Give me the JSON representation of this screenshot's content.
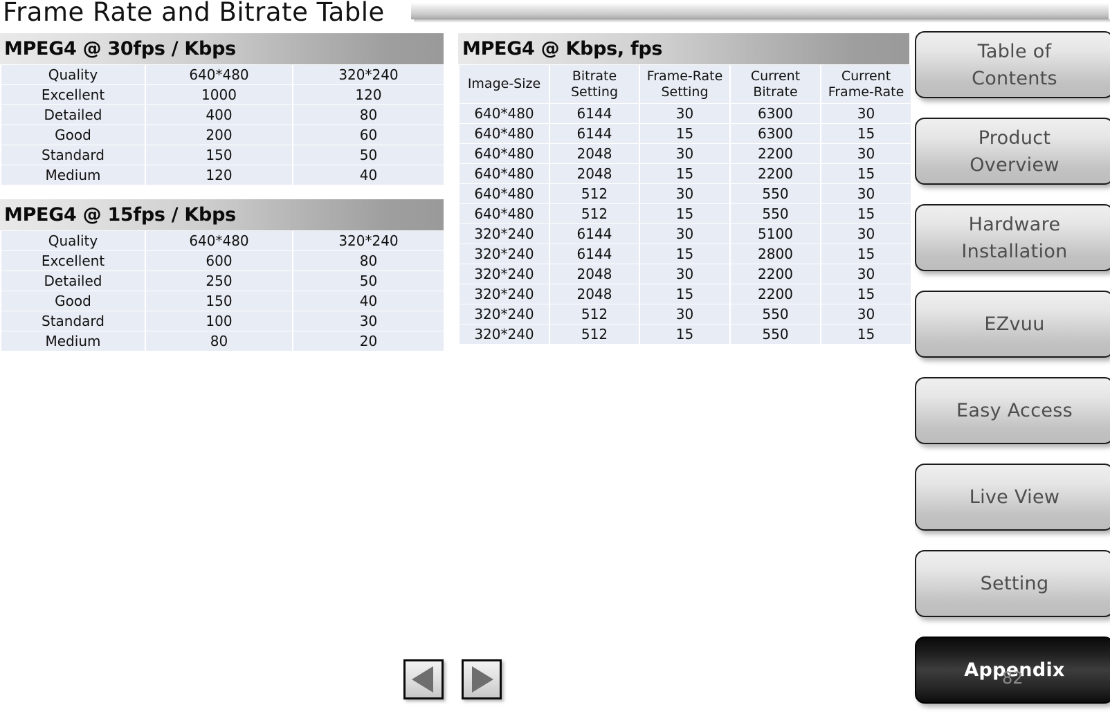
{
  "slide": {
    "title": "Frame Rate and Bitrate Table",
    "page_number": "82"
  },
  "tables": {
    "mpeg4_30fps": {
      "header": "MPEG4 @ 30fps / Kbps",
      "columns": [
        "Quality",
        "640*480",
        "320*240"
      ],
      "rows": [
        [
          "Excellent",
          "1000",
          "120"
        ],
        [
          "Detailed",
          "400",
          "80"
        ],
        [
          "Good",
          "200",
          "60"
        ],
        [
          "Standard",
          "150",
          "50"
        ],
        [
          "Medium",
          "120",
          "40"
        ]
      ]
    },
    "mpeg4_15fps": {
      "header": "MPEG4 @ 15fps / Kbps",
      "columns": [
        "Quality",
        "640*480",
        "320*240"
      ],
      "rows": [
        [
          "Excellent",
          "600",
          "80"
        ],
        [
          "Detailed",
          "250",
          "50"
        ],
        [
          "Good",
          "150",
          "40"
        ],
        [
          "Standard",
          "100",
          "30"
        ],
        [
          "Medium",
          "80",
          "20"
        ]
      ]
    },
    "mpeg4_kbps_fps": {
      "header": "MPEG4 @ Kbps, fps",
      "columns": [
        {
          "line1": "Image-Size",
          "line2": ""
        },
        {
          "line1": "Bitrate",
          "line2": "Setting"
        },
        {
          "line1": "Frame-Rate",
          "line2": "Setting"
        },
        {
          "line1": "Current",
          "line2": "Bitrate"
        },
        {
          "line1": "Current",
          "line2": "Frame-Rate"
        }
      ],
      "rows": [
        [
          "640*480",
          "6144",
          "30",
          "6300",
          "30"
        ],
        [
          "640*480",
          "6144",
          "15",
          "6300",
          "15"
        ],
        [
          "640*480",
          "2048",
          "30",
          "2200",
          "30"
        ],
        [
          "640*480",
          "2048",
          "15",
          "2200",
          "15"
        ],
        [
          "640*480",
          "512",
          "30",
          "550",
          "30"
        ],
        [
          "640*480",
          "512",
          "15",
          "550",
          "15"
        ],
        [
          "320*240",
          "6144",
          "30",
          "5100",
          "30"
        ],
        [
          "320*240",
          "6144",
          "15",
          "2800",
          "15"
        ],
        [
          "320*240",
          "2048",
          "30",
          "2200",
          "30"
        ],
        [
          "320*240",
          "2048",
          "15",
          "2200",
          "15"
        ],
        [
          "320*240",
          "512",
          "30",
          "550",
          "30"
        ],
        [
          "320*240",
          "512",
          "15",
          "550",
          "15"
        ]
      ]
    }
  },
  "sidebar": {
    "items": [
      {
        "line1": "Table of",
        "line2": "Contents",
        "active": false
      },
      {
        "line1": "Product",
        "line2": "Overview",
        "active": false
      },
      {
        "line1": "Hardware",
        "line2": "Installation",
        "active": false
      },
      {
        "line1": "EZvuu",
        "line2": "",
        "active": false
      },
      {
        "line1": "Easy Access",
        "line2": "",
        "active": false
      },
      {
        "line1": "Live View",
        "line2": "",
        "active": false
      },
      {
        "line1": "Setting",
        "line2": "",
        "active": false
      },
      {
        "line1": "Appendix",
        "line2": "",
        "active": true
      }
    ]
  },
  "page_nav": {
    "prev_icon": "triangle-left-icon",
    "next_icon": "triangle-right-icon"
  }
}
